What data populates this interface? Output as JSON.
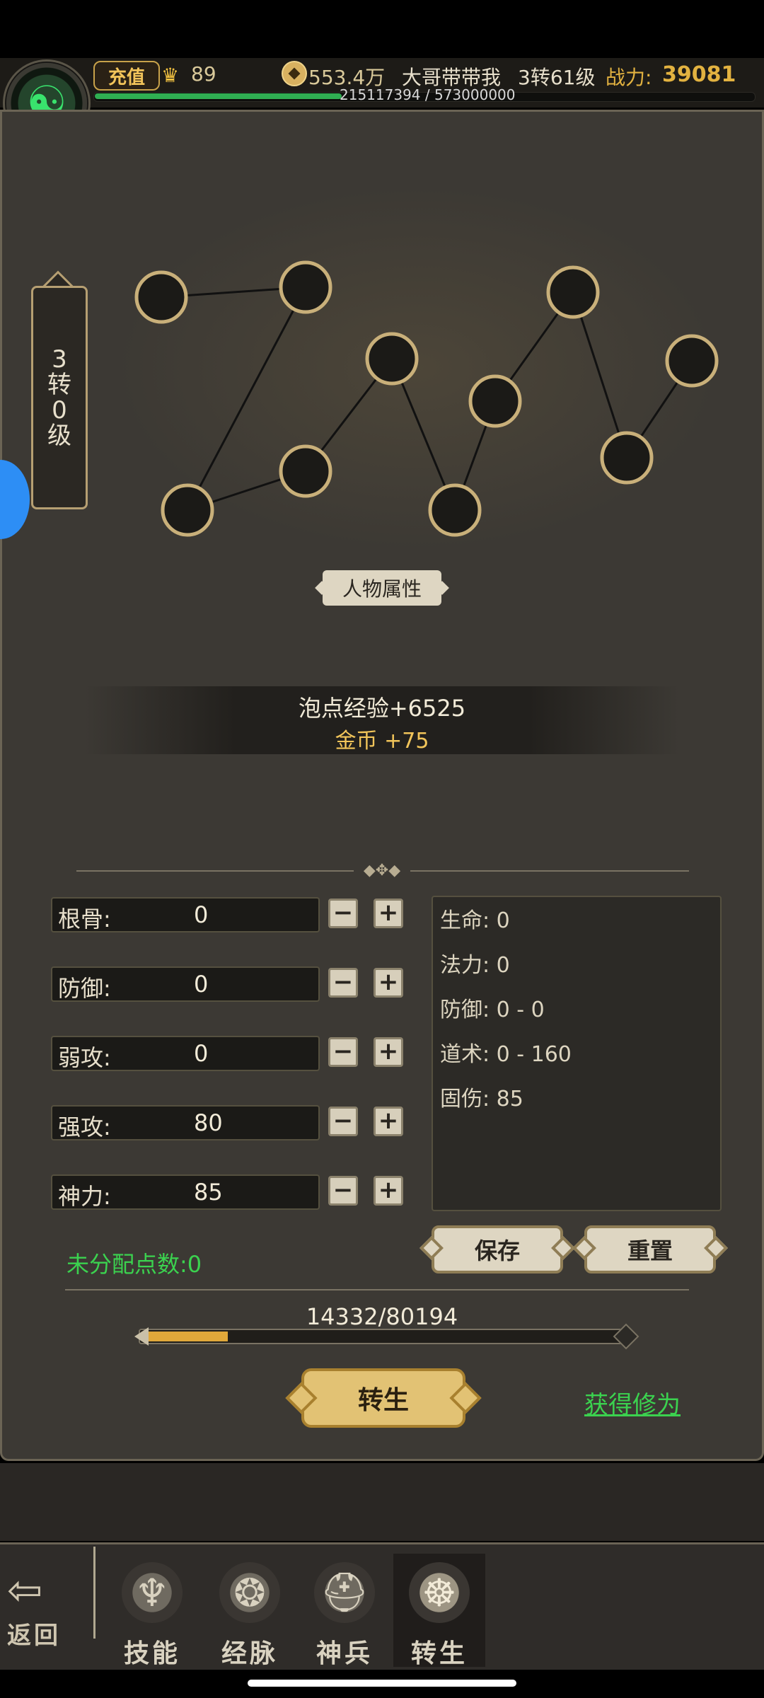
{
  "header": {
    "recharge_label": "充值",
    "ingot_icon": "ingot-icon",
    "ingot_value": "89",
    "coin_icon": "coin-icon",
    "gold_value": "553.4万",
    "player_name": "大哥带带我",
    "player_level": "3转61级",
    "power_label": "战力:",
    "power_value": "39081",
    "exp_text": "215117394 / 573000000",
    "exp_fraction": 0.375
  },
  "rank_plaque": [
    "3",
    "转",
    "0",
    "级"
  ],
  "attr_tag": "人物属性",
  "rewards": {
    "exp": "泡点经验+6525",
    "gold": "金币 +75"
  },
  "stats": [
    {
      "label": "根骨:",
      "value": "0"
    },
    {
      "label": "防御:",
      "value": "0"
    },
    {
      "label": "弱攻:",
      "value": "0"
    },
    {
      "label": "强攻:",
      "value": "80"
    },
    {
      "label": "神力:",
      "value": "85"
    }
  ],
  "derived": [
    "生命: 0",
    "法力: 0",
    "防御: 0 - 0",
    "道术: 0 - 160",
    "固伤: 85"
  ],
  "buttons": {
    "save": "保存",
    "reset": "重置",
    "rebirth": "转生",
    "get_cultivation": "获得修为",
    "minus": "−",
    "plus": "+"
  },
  "unallocated": "未分配点数:0",
  "cultivation": {
    "text": "14332/80194",
    "fraction": 0.179
  },
  "nav": {
    "back": "返回",
    "tabs": [
      {
        "label": "技能",
        "icon": "skill-icon"
      },
      {
        "label": "经脉",
        "icon": "meridian-icon"
      },
      {
        "label": "神兵",
        "icon": "weapon-icon"
      },
      {
        "label": "转生",
        "icon": "rebirth-icon",
        "active": true
      }
    ]
  },
  "colors": {
    "accent_gold": "#e2b240",
    "green": "#3bd24f",
    "panel": "#3c3934"
  }
}
